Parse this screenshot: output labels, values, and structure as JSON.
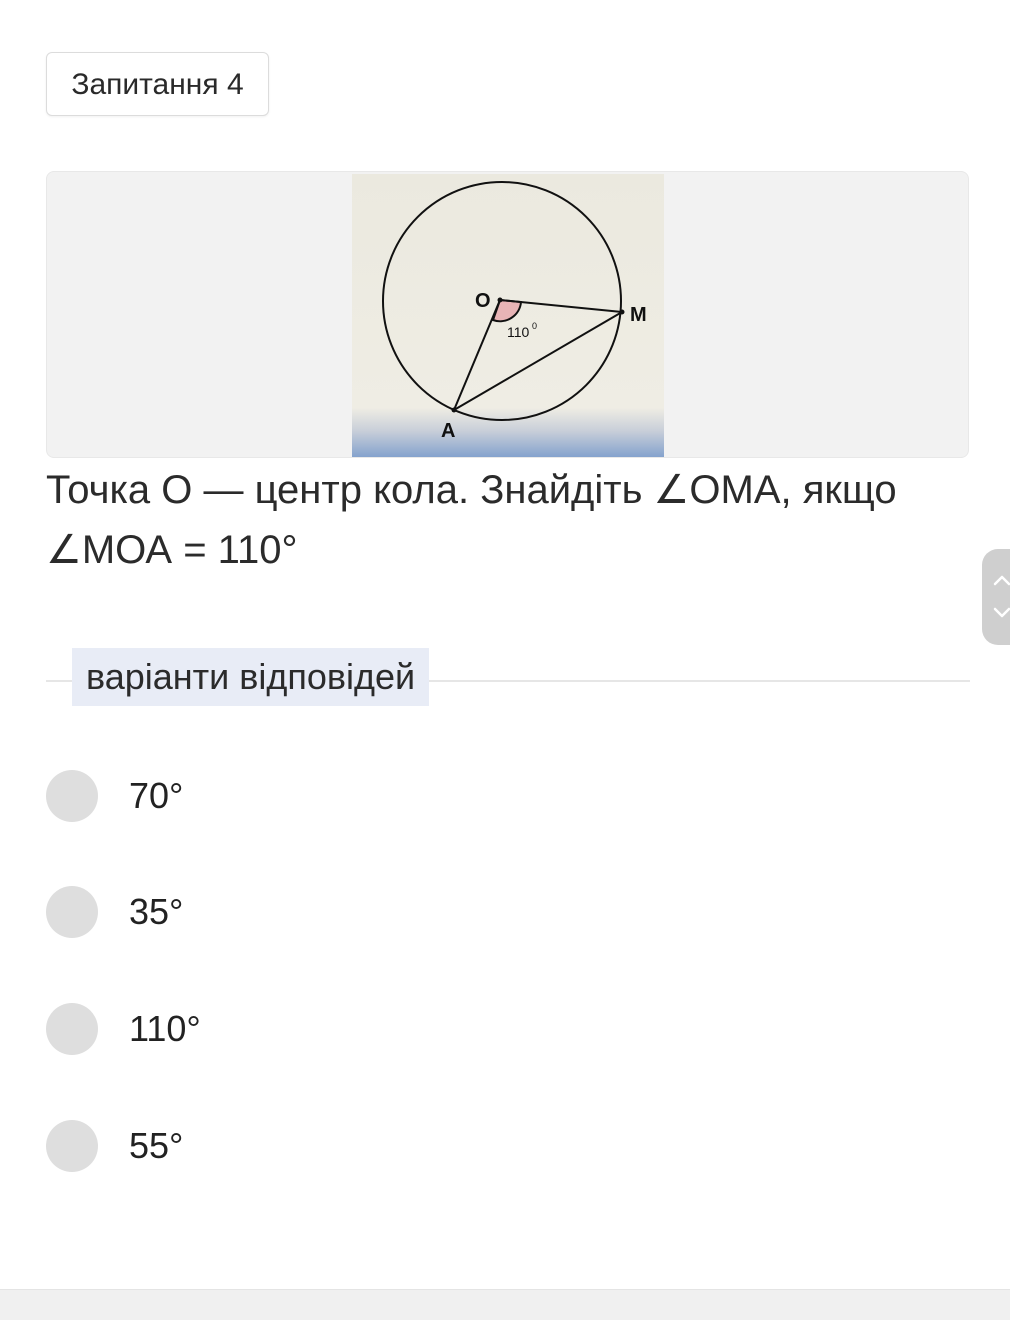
{
  "question": {
    "badge": "Запитання 4",
    "text": "Точка О — центр кола. Знайдіть ∠ОМА, якщо ∠МОА = 110°"
  },
  "figure": {
    "label_o": "O",
    "label_m": "M",
    "label_a": "A",
    "angle_value": "110",
    "angle_degree_mark": "0",
    "colors": {
      "background": "#efede4",
      "angle_fill": "#e8b4b6",
      "bottom_gradient": "#7f9fcc"
    }
  },
  "answers": {
    "section_label": "варіанти відповідей",
    "options": [
      {
        "label": "70°"
      },
      {
        "label": "35°"
      },
      {
        "label": "110°"
      },
      {
        "label": "55°"
      }
    ]
  },
  "scroll_controls": {
    "up_icon": "chevron-up-icon",
    "down_icon": "chevron-down-icon"
  }
}
